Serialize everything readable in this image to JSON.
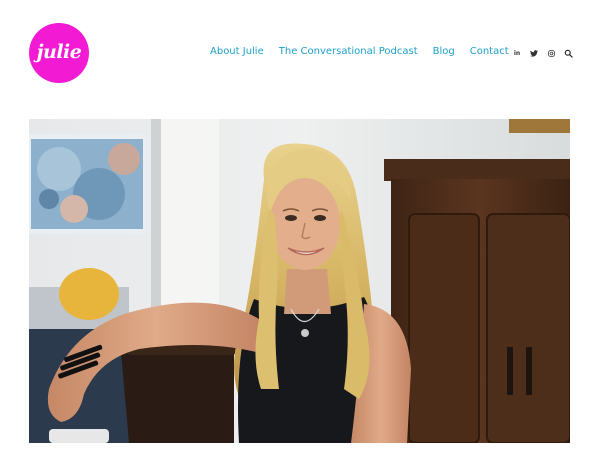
{
  "logo": {
    "text": "julie",
    "color": "#f21ad3"
  },
  "nav": [
    {
      "label": "About Julie"
    },
    {
      "label": "The Conversational Podcast"
    },
    {
      "label": "Blog"
    },
    {
      "label": "Contact"
    }
  ],
  "social_icons": [
    {
      "name": "linkedin-icon",
      "glyph": "in"
    },
    {
      "name": "twitter-icon",
      "glyph": "t"
    },
    {
      "name": "instagram-icon",
      "glyph": "◎"
    }
  ],
  "accent_color": "#1fa0c8"
}
